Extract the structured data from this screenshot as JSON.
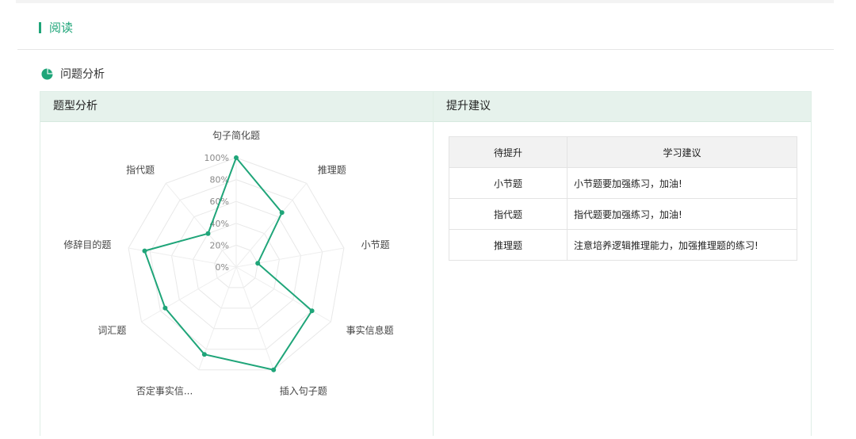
{
  "section": {
    "title": "阅读"
  },
  "sub": {
    "title": "问题分析"
  },
  "left_panel": {
    "title": "题型分析"
  },
  "right_panel": {
    "title": "提升建议"
  },
  "table": {
    "headers": [
      "待提升",
      "学习建议"
    ],
    "rows": [
      [
        "小节题",
        "小节题要加强练习，加油!"
      ],
      [
        "指代题",
        "指代题要加强练习，加油!"
      ],
      [
        "推理题",
        "注意培养逻辑推理能力，加强推理题的练习!"
      ]
    ]
  },
  "colors": {
    "accent": "#1fa579",
    "panel_header_bg": "#e6f2ec"
  },
  "icons": {
    "section": "accent-bar",
    "sub": "pie-chart-icon"
  },
  "chart_data": {
    "type": "radar",
    "categories": [
      "句子简化题",
      "推理题",
      "小节题",
      "事实信息题",
      "插入句子题",
      "否定事实信...",
      "词汇题",
      "修辞目的题",
      "指代题"
    ],
    "values": [
      100,
      65,
      20,
      80,
      100,
      85,
      75,
      85,
      40
    ],
    "radial_ticks": [
      "0%",
      "20%",
      "40%",
      "60%",
      "80%",
      "100%"
    ],
    "range": [
      0,
      100
    ],
    "grid": true
  }
}
